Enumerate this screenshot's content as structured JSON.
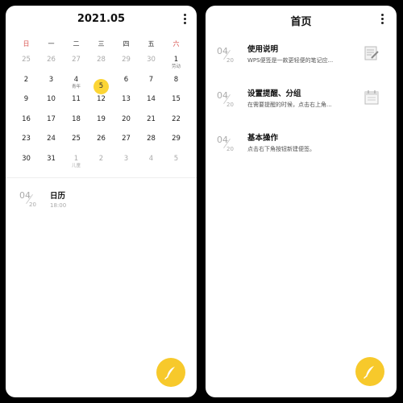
{
  "left": {
    "title": "2021.05",
    "weekdays": [
      "日",
      "一",
      "二",
      "三",
      "四",
      "五",
      "六"
    ],
    "weeks": [
      [
        {
          "n": "25",
          "o": true
        },
        {
          "n": "26",
          "o": true
        },
        {
          "n": "27",
          "o": true
        },
        {
          "n": "28",
          "o": true
        },
        {
          "n": "29",
          "o": true
        },
        {
          "n": "30",
          "o": true
        },
        {
          "n": "1",
          "s": "劳动"
        }
      ],
      [
        {
          "n": "2"
        },
        {
          "n": "3"
        },
        {
          "n": "4",
          "s": "青年"
        },
        {
          "n": "5",
          "t": true
        },
        {
          "n": "6"
        },
        {
          "n": "7"
        },
        {
          "n": "8"
        }
      ],
      [
        {
          "n": "9"
        },
        {
          "n": "10"
        },
        {
          "n": "11"
        },
        {
          "n": "12"
        },
        {
          "n": "13"
        },
        {
          "n": "14"
        },
        {
          "n": "15"
        }
      ],
      [
        {
          "n": "16"
        },
        {
          "n": "17"
        },
        {
          "n": "18"
        },
        {
          "n": "19"
        },
        {
          "n": "20"
        },
        {
          "n": "21"
        },
        {
          "n": "22"
        }
      ],
      [
        {
          "n": "23"
        },
        {
          "n": "24"
        },
        {
          "n": "25"
        },
        {
          "n": "26"
        },
        {
          "n": "27"
        },
        {
          "n": "28"
        },
        {
          "n": "29"
        }
      ],
      [
        {
          "n": "30"
        },
        {
          "n": "31"
        },
        {
          "n": "1",
          "s": "儿童",
          "o": true
        },
        {
          "n": "2",
          "o": true
        },
        {
          "n": "3",
          "o": true
        },
        {
          "n": "4",
          "o": true
        },
        {
          "n": "5",
          "o": true
        }
      ]
    ],
    "note": {
      "month": "04",
      "day": "20",
      "title": "日历",
      "time": "18:00"
    }
  },
  "right": {
    "title": "首页",
    "notes": [
      {
        "month": "04",
        "day": "20",
        "title": "使用说明",
        "sub": "WPS便签是一款更轻便的笔记应..."
      },
      {
        "month": "04",
        "day": "20",
        "title": "设置提醒、分组",
        "sub": "在需要提醒的时候，点击右上角..."
      },
      {
        "month": "04",
        "day": "20",
        "title": "基本操作",
        "sub": "点击右下角按钮新建便签。"
      }
    ]
  },
  "colors": {
    "accent": "#f7c92b",
    "weekend": "#d9534f"
  },
  "icons": {
    "more": "more-vertical-icon",
    "fab": "feather-pen-icon"
  }
}
